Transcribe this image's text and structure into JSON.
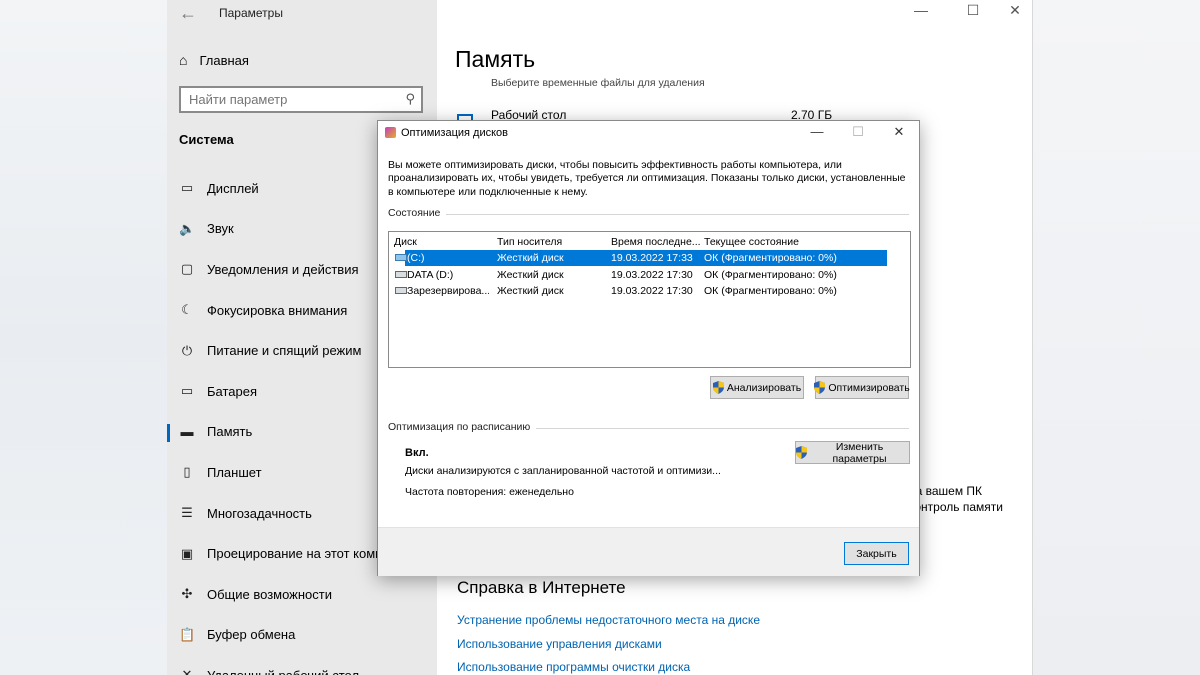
{
  "settings": {
    "app_title": "Параметры",
    "back_glyph": "←",
    "controls": {
      "minimize": "—",
      "maximize": "☐",
      "close": "✕"
    },
    "sidebar": {
      "home_label": "Главная",
      "search_placeholder": "Найти параметр",
      "section_title": "Система",
      "items": [
        {
          "icon": "display-icon",
          "glyph": "▭",
          "label": "Дисплей"
        },
        {
          "icon": "sound-icon",
          "glyph": "🔈",
          "label": "Звук"
        },
        {
          "icon": "notifications-icon",
          "glyph": "▢",
          "label": "Уведомления и действия"
        },
        {
          "icon": "focus-assist-icon",
          "glyph": "☾",
          "label": "Фокусировка внимания"
        },
        {
          "icon": "power-icon",
          "glyph": "⏻",
          "label": "Питание и спящий режим"
        },
        {
          "icon": "battery-icon",
          "glyph": "▭",
          "label": "Батарея"
        },
        {
          "icon": "storage-icon",
          "glyph": "▬",
          "label": "Память",
          "active": true
        },
        {
          "icon": "tablet-icon",
          "glyph": "▯",
          "label": "Планшет"
        },
        {
          "icon": "multitasking-icon",
          "glyph": "☰",
          "label": "Многозадачность"
        },
        {
          "icon": "projecting-icon",
          "glyph": "▣",
          "label": "Проецирование на этот компьютер"
        },
        {
          "icon": "shared-experiences-icon",
          "glyph": "✣",
          "label": "Общие возможности"
        },
        {
          "icon": "clipboard-icon",
          "glyph": "📋",
          "label": "Буфер обмена"
        },
        {
          "icon": "remote-desktop-icon",
          "glyph": "✕",
          "label": "Удаленный рабочий стол"
        }
      ]
    },
    "main": {
      "page_title": "Память",
      "subtitle": "Выберите временные файлы для удаления",
      "item_label": "Рабочий стол",
      "item_size": "2.70 ГБ",
      "peek_line1": "на вашем ПК",
      "peek_line2": "контроль памяти",
      "help_title": "Справка в Интернете",
      "help_links": [
        "Устранение проблемы недостаточного места на диске",
        "Использование управления дисками",
        "Использование программы очистки диска"
      ]
    }
  },
  "dialog": {
    "title": "Оптимизация дисков",
    "controls": {
      "minimize": "—",
      "maximize": "☐",
      "close": "✕"
    },
    "description": "Вы можете оптимизировать диски, чтобы повысить эффективность работы  компьютера, или проанализировать их, чтобы увидеть, требуется ли оптимизация. Показаны только диски, установленные в компьютере или подключенные к нему.",
    "status_group": "Состояние",
    "columns": [
      "Диск",
      "Тип носителя",
      "Время последне...",
      "Текущее состояние"
    ],
    "drives": [
      {
        "icon": "system-drive-icon",
        "name": "(C:)",
        "media": "Жесткий диск",
        "last_run": "19.03.2022 17:33",
        "status": "ОК (Фрагментировано: 0%)",
        "selected": true
      },
      {
        "icon": "drive-icon",
        "name": "DATA (D:)",
        "media": "Жесткий диск",
        "last_run": "19.03.2022 17:30",
        "status": "ОК (Фрагментировано: 0%)",
        "selected": false
      },
      {
        "icon": "drive-icon",
        "name": "Зарезервирова...",
        "media": "Жесткий диск",
        "last_run": "19.03.2022 17:30",
        "status": "ОК (Фрагментировано: 0%)",
        "selected": false
      }
    ],
    "analyze_label": "Анализировать",
    "optimize_label": "Оптимизировать",
    "schedule_group": "Оптимизация по расписанию",
    "schedule_state": "Вкл.",
    "schedule_desc": "Диски анализируются с запланированной частотой и оптимизи...",
    "schedule_freq": "Частота повторения: еженедельно",
    "change_settings_label": "Изменить параметры",
    "close_label": "Закрыть"
  }
}
